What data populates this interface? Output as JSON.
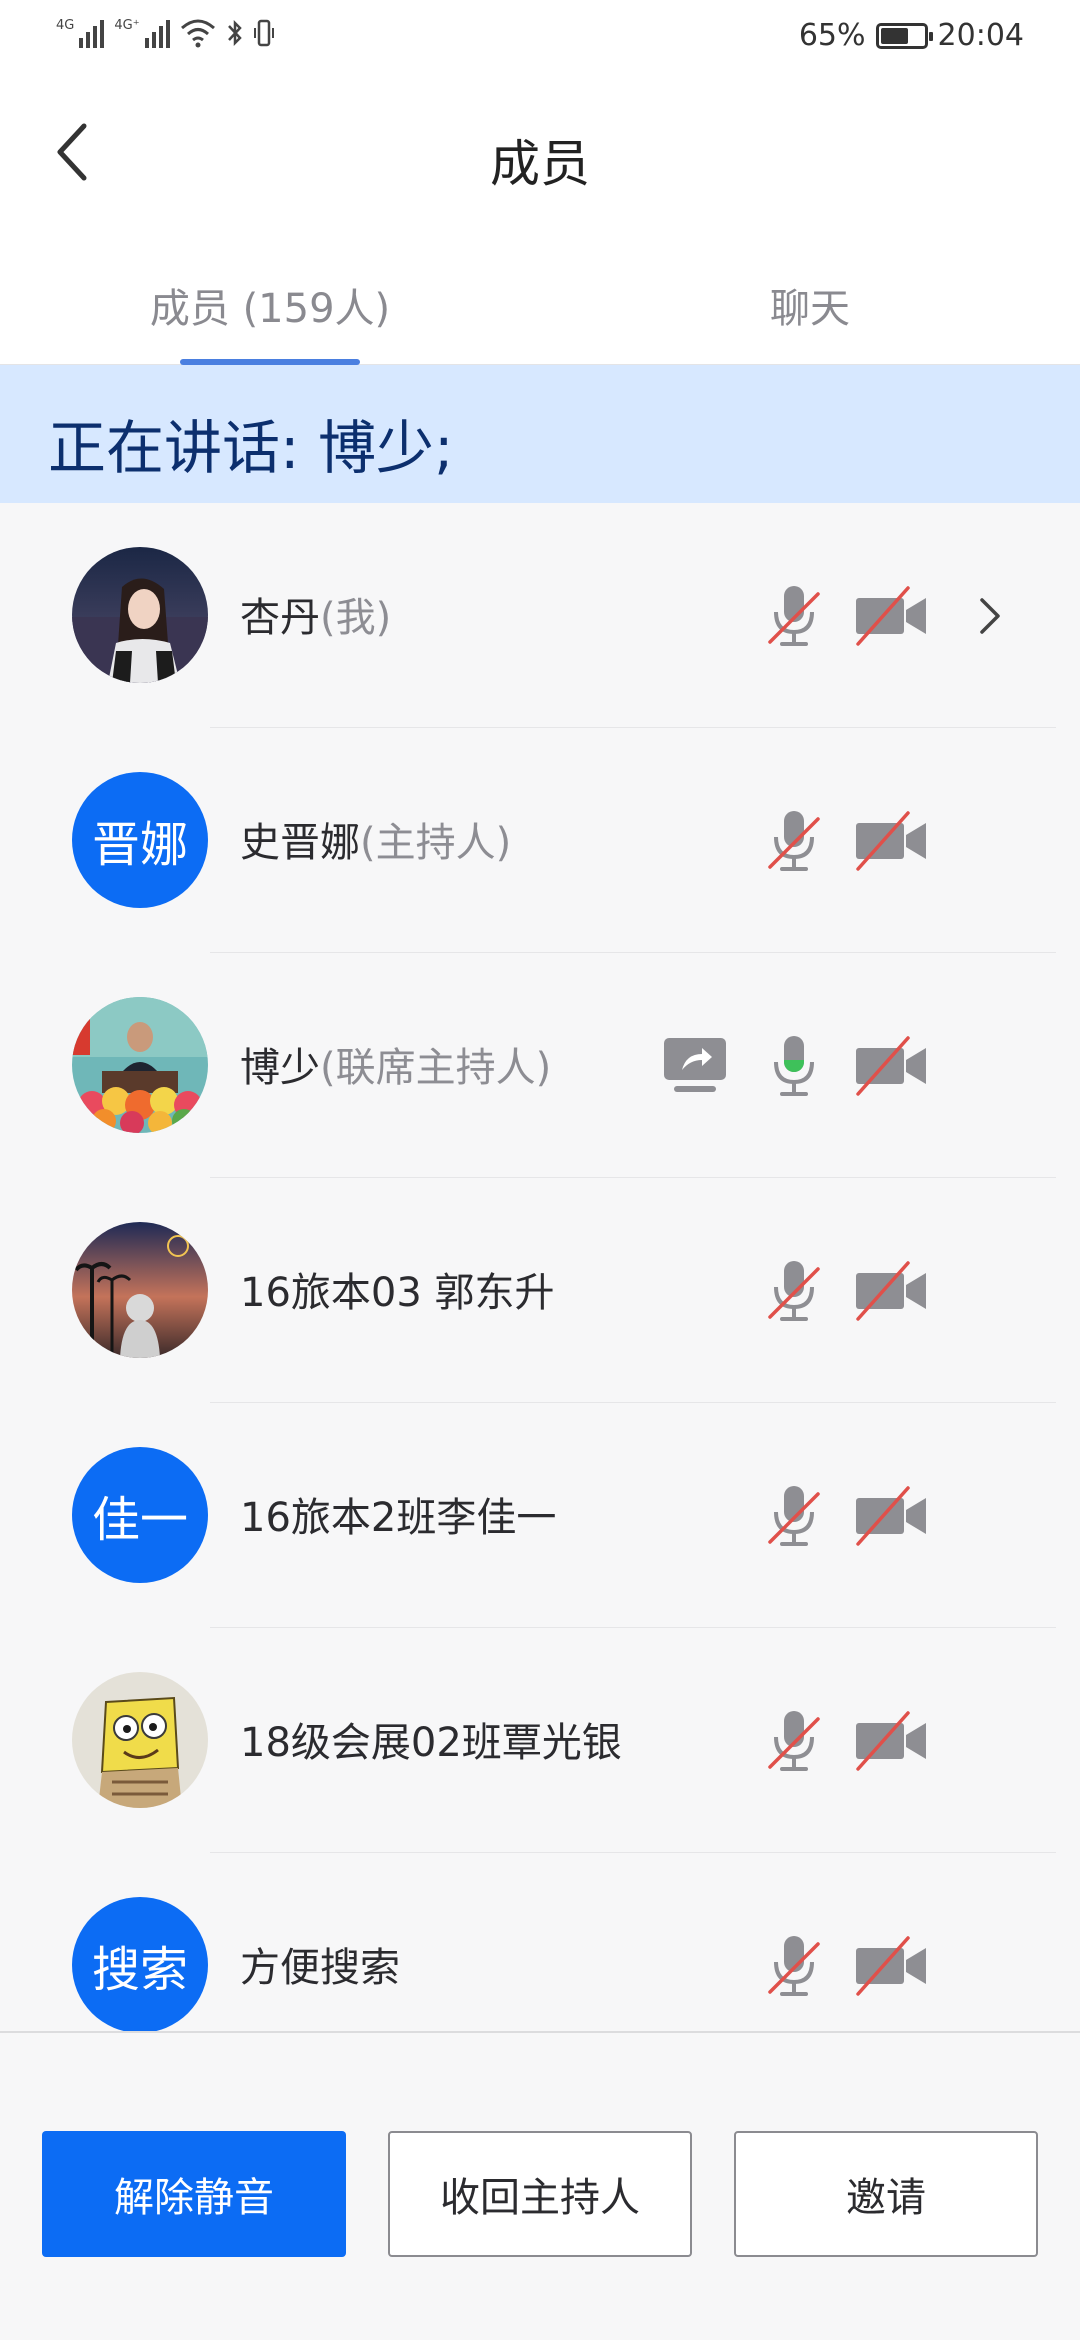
{
  "status_bar": {
    "signal_1_label": "4G",
    "signal_2_label": "4G⁺",
    "battery_percent": "65%",
    "battery_level": 0.65,
    "time": "20:04"
  },
  "header": {
    "title": "成员"
  },
  "tabs": [
    {
      "label": "成员 (159人)",
      "selected": true
    },
    {
      "label": "聊天",
      "selected": false
    }
  ],
  "speaking_banner": "正在讲话: 博少;",
  "members": [
    {
      "name": "杏丹",
      "role": "(我)",
      "avatar": "photo-woman",
      "mic": "muted",
      "camera": "off",
      "has_chevron": true,
      "sharing": false
    },
    {
      "name": "史晋娜",
      "role": "(主持人)",
      "avatar_text": "晋娜",
      "mic": "muted",
      "camera": "off",
      "has_chevron": false,
      "sharing": false
    },
    {
      "name": "博少",
      "role": "(联席主持人)",
      "avatar": "photo-podium",
      "mic": "active",
      "camera": "off",
      "has_chevron": false,
      "sharing": true
    },
    {
      "name": "16旅本03 郭东升",
      "role": "",
      "avatar": "photo-sunset",
      "mic": "muted",
      "camera": "off",
      "has_chevron": false,
      "sharing": false
    },
    {
      "name": "16旅本2班李佳一",
      "role": "",
      "avatar_text": "佳一",
      "mic": "muted",
      "camera": "off",
      "has_chevron": false,
      "sharing": false
    },
    {
      "name": "18级会展02班覃光银",
      "role": "",
      "avatar": "photo-cartoon",
      "mic": "muted",
      "camera": "off",
      "has_chevron": false,
      "sharing": false
    },
    {
      "name": "方便搜索",
      "role": "",
      "avatar_text": "搜索",
      "mic": "muted",
      "camera": "off",
      "has_chevron": false,
      "sharing": false
    }
  ],
  "colors": {
    "accent": "#0c6cf4",
    "banner_bg": "#d7e8ff",
    "banner_text": "#0c2f6e",
    "muted_slash": "#e0504a",
    "mic_active": "#3ec15a"
  },
  "bottom_actions": {
    "unmute_label": "解除静音",
    "revoke_host_label": "收回主持人",
    "invite_label": "邀请"
  }
}
